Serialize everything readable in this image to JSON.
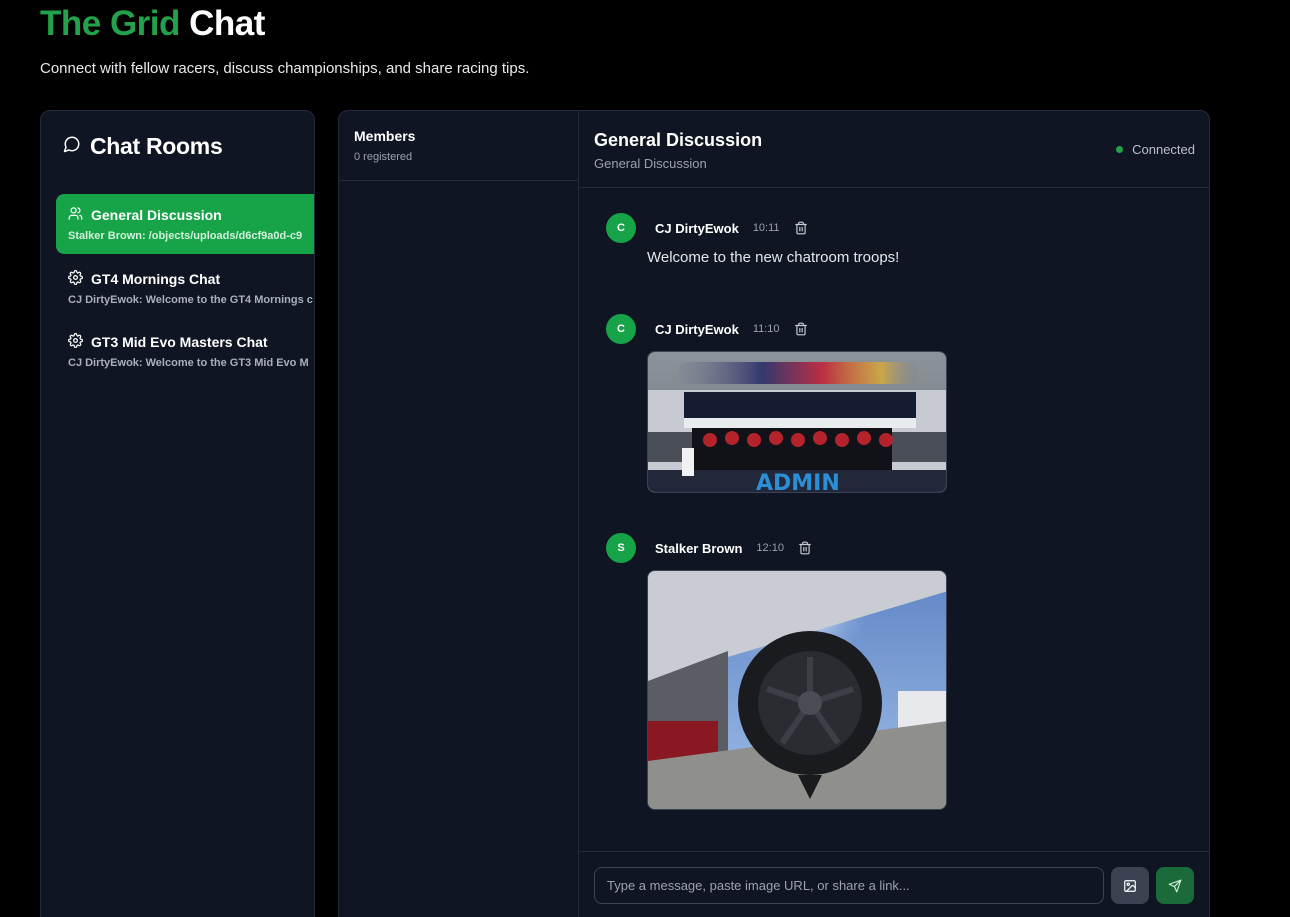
{
  "page": {
    "title_green": "The Grid",
    "title_white": "Chat",
    "subtitle": "Connect with fellow racers, discuss championships, and share racing tips."
  },
  "sidebar": {
    "title": "Chat Rooms",
    "rooms": [
      {
        "name": "General Discussion",
        "preview": "Stalker Brown: /objects/uploads/d6cf9a0d-c9",
        "icon": "users-icon",
        "active": true
      },
      {
        "name": "GT4 Mornings Chat",
        "preview": "CJ DirtyEwok: Welcome to the GT4 Mornings c",
        "icon": "gear-icon",
        "active": false
      },
      {
        "name": "GT3 Mid Evo Masters Chat",
        "preview": "CJ DirtyEwok: Welcome to the GT3 Mid Evo M",
        "icon": "gear-icon",
        "active": false
      }
    ]
  },
  "members": {
    "title": "Members",
    "count": "0 registered"
  },
  "chat": {
    "title": "General Discussion",
    "subtitle": "General Discussion",
    "status": "Connected",
    "messages": [
      {
        "avatar": "C",
        "author": "CJ DirtyEwok",
        "time": "10:11",
        "text": "Welcome to the new chatroom troops!"
      },
      {
        "avatar": "C",
        "author": "CJ DirtyEwok",
        "time": "11:10",
        "image": "racing-pit-wall-photo",
        "watermark": "ADMIN"
      },
      {
        "avatar": "S",
        "author": "Stalker Brown",
        "time": "12:10",
        "image": "race-tyre-photo"
      }
    ]
  },
  "composer": {
    "placeholder": "Type a message, paste image URL, or share a link..."
  },
  "colors": {
    "accent": "#22a24a",
    "active_room": "#17a348",
    "panel": "#0f1522",
    "border": "#232b3a"
  }
}
